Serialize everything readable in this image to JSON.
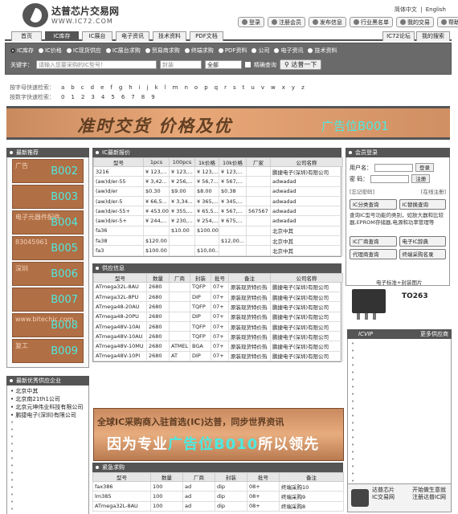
{
  "header": {
    "brand": "达普芯片交易网",
    "url": "WWW.IC72.COM",
    "lang_cn": "简体中文",
    "lang_sep": "|",
    "lang_en": "English",
    "buttons": [
      "登录",
      "注册会员",
      "发布信息",
      "行业黑名单",
      "我的交易",
      "帮助"
    ]
  },
  "nav": {
    "tabs": [
      "首页",
      "IC库存",
      "IC展台",
      "电子资讯",
      "技术资料",
      "PDF文档"
    ],
    "right_tabs": [
      "IC72论坛",
      "我的搜索"
    ]
  },
  "search": {
    "options": [
      "IC库存",
      "IC价格",
      "IC现货供应",
      "IC展台求购",
      "贸易商求购",
      "终端求购",
      "PDF资料",
      "公司",
      "电子资讯",
      "技术资料"
    ],
    "keyword_label": "关键字：",
    "keyword_placeholder": "请输入您要采购的IC型号！",
    "brand_placeholder": "封装",
    "select_value": "全部",
    "exact_label": "精确查询",
    "submit_label": "达普一下"
  },
  "alpha": {
    "letter_label": "按字母快速检索：",
    "letters": [
      "a",
      "b",
      "c",
      "d",
      "e",
      "f",
      "g",
      "h",
      "i",
      "j",
      "k",
      "l",
      "m",
      "n",
      "o",
      "p",
      "q",
      "r",
      "s",
      "t",
      "u",
      "v",
      "w",
      "x",
      "y",
      "z"
    ],
    "digit_label": "按数字快速检索：",
    "digits": [
      "0",
      "1",
      "2",
      "3",
      "4",
      "5",
      "6",
      "7",
      "8",
      "9"
    ]
  },
  "banner_top": {
    "slogan": "准时交货 价格及优",
    "ad": "广告位B001"
  },
  "left": {
    "recommend_title": "最新推荐",
    "ads": [
      {
        "code": "B002",
        "sub": "广告"
      },
      {
        "code": "B003",
        "sub": ""
      },
      {
        "code": "B004",
        "sub": "电子元器件配件"
      },
      {
        "code": "B005",
        "sub": "83045961"
      },
      {
        "code": "B006",
        "sub": "深圳"
      },
      {
        "code": "B007",
        "sub": ""
      },
      {
        "code": "B008",
        "sub": "www.bitechic.com"
      },
      {
        "code": "B009",
        "sub": "复工"
      }
    ],
    "company_title": "最新优秀供应企业",
    "companies": [
      "北京中其",
      "北京南21th1公司",
      "北京元坤伟业科技有限公司",
      "鹏捷电子(深圳)有限公司"
    ]
  },
  "price_table": {
    "title": "IC最新报价",
    "headers": [
      "型号",
      "1pcs",
      "100pcs",
      "1k价格",
      "10k价格",
      "厂家",
      "公司名称"
    ],
    "rows": [
      [
        "3216",
        "¥ 123,...",
        "¥ 123,...",
        "¥ 123,...",
        "¥ 123,...",
        "",
        "鹏捷电子(深圳)有限公司"
      ],
      [
        "(aw)d/er-55",
        "¥ 3,42...",
        "¥ 256,...",
        "¥ 56,7...",
        "¥ 567,...",
        "",
        "adwadad"
      ],
      [
        "(aw)d/er",
        "$0.30",
        "$9.00",
        "$8.00",
        "$0.38",
        "",
        "adwadad"
      ],
      [
        "(aw)d/er-5",
        "¥ 66,5...",
        "¥ 3,34...",
        "¥ 365,...",
        "¥ 345,...",
        "",
        "adwadad"
      ],
      [
        "(aw)d/er-55+",
        "¥ 453.00",
        "¥ 355,...",
        "¥ 65,5...",
        "¥ 567,...",
        "567567",
        "adwadad"
      ],
      [
        "(aw)d/er-5+",
        "¥ 244,...",
        "¥ 230,...",
        "¥ 254,...",
        "¥ 675,...",
        "",
        "adwadad"
      ],
      [
        "fa36",
        "",
        "$10.00",
        "$100.00",
        "",
        "",
        "北京中其"
      ],
      [
        "fa38",
        "$120.00",
        "",
        "",
        "$12,00...",
        "",
        "北京中其"
      ],
      [
        "fa3",
        "$100.00",
        "",
        "$10,00...",
        "",
        "",
        "北京中其"
      ]
    ]
  },
  "supply_table": {
    "title": "供应信息",
    "headers": [
      "型号",
      "数量",
      "厂商",
      "封装",
      "批号",
      "备注",
      "公司名称"
    ],
    "rows": [
      [
        "ATmega32L-8AU",
        "2680",
        "",
        "TQFP",
        "07+",
        "原装现货特价热",
        "鹏捷电子(深圳)有限公司"
      ],
      [
        "ATmega32L-8PU",
        "2680",
        "",
        "DIP",
        "07+",
        "原装现货特价热",
        "鹏捷电子(深圳)有限公司"
      ],
      [
        "ATmega48-20AU",
        "2680",
        "",
        "TQFP",
        "07+",
        "原装现货特价热",
        "鹏捷电子(深圳)有限公司"
      ],
      [
        "ATmega48-20PU",
        "2680",
        "",
        "DIP",
        "07+",
        "原装现货特价热",
        "鹏捷电子(深圳)有限公司"
      ],
      [
        "ATmega48V-10AI",
        "2680",
        "",
        "TQFP",
        "07+",
        "原装现货特价热",
        "鹏捷电子(深圳)有限公司"
      ],
      [
        "ATmega48V-10AU",
        "2680",
        "",
        "TQFP",
        "07+",
        "原装现货特价热",
        "鹏捷电子(深圳)有限公司"
      ],
      [
        "ATmega48V-10MU",
        "2680",
        "ATMEL",
        "BGA",
        "07+",
        "原装现货特价热",
        "鹏捷电子(深圳)有限公司"
      ],
      [
        "ATmega48V-10PI",
        "2680",
        "AT",
        "DIP",
        "07+",
        "原装现货特价热",
        "鹏捷电子(深圳)有限公司"
      ]
    ]
  },
  "mid_ad": {
    "line1": "全球IC采购商入驻首选(IC)达普，同步世界资讯",
    "line2a": "因为专业",
    "line2b": "广告位B010",
    "line2c": "所以领先"
  },
  "urgent_table": {
    "title": "紧急求购",
    "headers": [
      "型号",
      "数量",
      "厂商",
      "封装",
      "批号",
      "备注"
    ],
    "rows": [
      [
        "fax386",
        "100",
        "ad",
        "dip",
        "08+",
        "终端采购10"
      ],
      [
        "lm385",
        "100",
        "ad",
        "dip",
        "08+",
        "终端采购9"
      ],
      [
        "ATmega32L-8AU",
        "100",
        "ad",
        "dip",
        "08+",
        "终端采购8"
      ]
    ]
  },
  "right": {
    "login_title": "会员登录",
    "user_label": "用户名：",
    "pass_label": "密  码：",
    "login_btn": "登录",
    "reg_btn": "注册",
    "forgot": "[忘记密码]",
    "online": "[在线注册]",
    "ic_category_btn": "IC分类查询",
    "ic_replace_btn": "IC替换查询",
    "desc": "查询IC型号功能的类别，如放大器和比较器,EPROM存储器,电源和功率管理等",
    "factory_btn": "IC厂商查询",
    "dict_btn": "电子IC辞典",
    "agent_btn": "代理商查询",
    "term_btn": "终端采购名录",
    "chip_label": "电子标准+封装图片",
    "chip_model": "TO263",
    "vip_title": "ICVIP",
    "vip_more": "更多供应商",
    "footer_l1": "达普芯片",
    "footer_l2": "IC交易网",
    "footer_r1": "开始做生意就",
    "footer_r2": "注册达普IC网"
  }
}
